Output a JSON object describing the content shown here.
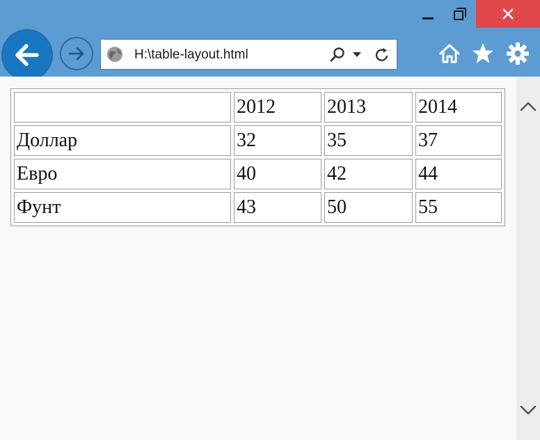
{
  "browser": {
    "url": "H:\\table-layout.html",
    "colors": {
      "chrome": "#5d9bd3",
      "close_button": "#e0474b",
      "back_button": "#1977c2"
    },
    "icons": {
      "back": "back-arrow-icon",
      "forward": "forward-arrow-icon",
      "site": "globe-icon",
      "search": "search-icon",
      "dropdown": "chevron-down-icon",
      "refresh": "refresh-icon",
      "home": "home-icon",
      "favorites": "star-icon",
      "tools": "gear-icon",
      "minimize": "minimize-icon",
      "restore": "restore-icon",
      "close": "close-icon"
    }
  },
  "table": {
    "header": [
      "",
      "2012",
      "2013",
      "2014"
    ],
    "rows": [
      [
        "Доллар",
        "32",
        "35",
        "37"
      ],
      [
        "Евро",
        "40",
        "42",
        "44"
      ],
      [
        "Фунт",
        "43",
        "50",
        "55"
      ]
    ]
  }
}
